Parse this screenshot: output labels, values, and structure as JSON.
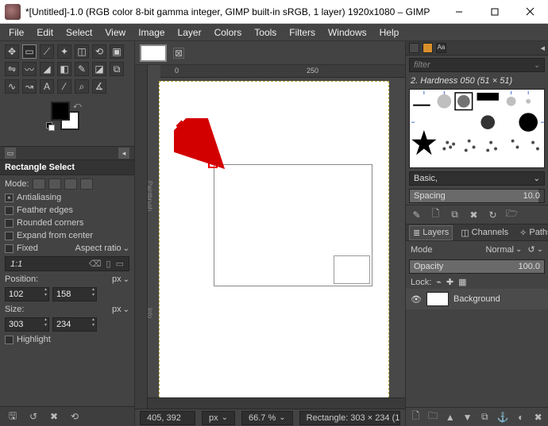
{
  "window": {
    "title": "*[Untitled]-1.0 (RGB color 8-bit gamma integer, GIMP built-in sRGB, 1 layer) 1920x1080 – GIMP"
  },
  "menu": [
    "File",
    "Edit",
    "Select",
    "View",
    "Image",
    "Layer",
    "Colors",
    "Tools",
    "Filters",
    "Windows",
    "Help"
  ],
  "toolbox": {
    "tool_title": "Rectangle Select",
    "mode_label": "Mode:",
    "antialiasing": "Antialiasing",
    "feather": "Feather edges",
    "rounded": "Rounded corners",
    "expand": "Expand from center",
    "fixed_label": "Fixed",
    "fixed_value": "Aspect ratio",
    "ratio": "1:1",
    "position_label": "Position:",
    "position_unit": "px",
    "position_x": "102",
    "position_y": "158",
    "size_label": "Size:",
    "size_unit": "px",
    "size_w": "303",
    "size_h": "234",
    "highlight": "Highlight"
  },
  "rulers": {
    "tick0": "0",
    "tick250": "250"
  },
  "status": {
    "coords": "405, 392",
    "unit": "px",
    "zoom": "66.7 %",
    "info": "Rectangle: 303 × 234 (1…"
  },
  "brushes": {
    "filter_placeholder": "filter",
    "current": "2. Hardness 050 (51 × 51)",
    "preset": "Basic,",
    "spacing_label": "Spacing",
    "spacing_value": "10.0"
  },
  "layers": {
    "tabs": {
      "layers": "Layers",
      "channels": "Channels",
      "paths": "Paths"
    },
    "mode_label": "Mode",
    "mode_value": "Normal",
    "opacity_label": "Opacity",
    "opacity_value": "100.0",
    "lock_label": "Lock:",
    "layer_name": "Background"
  }
}
